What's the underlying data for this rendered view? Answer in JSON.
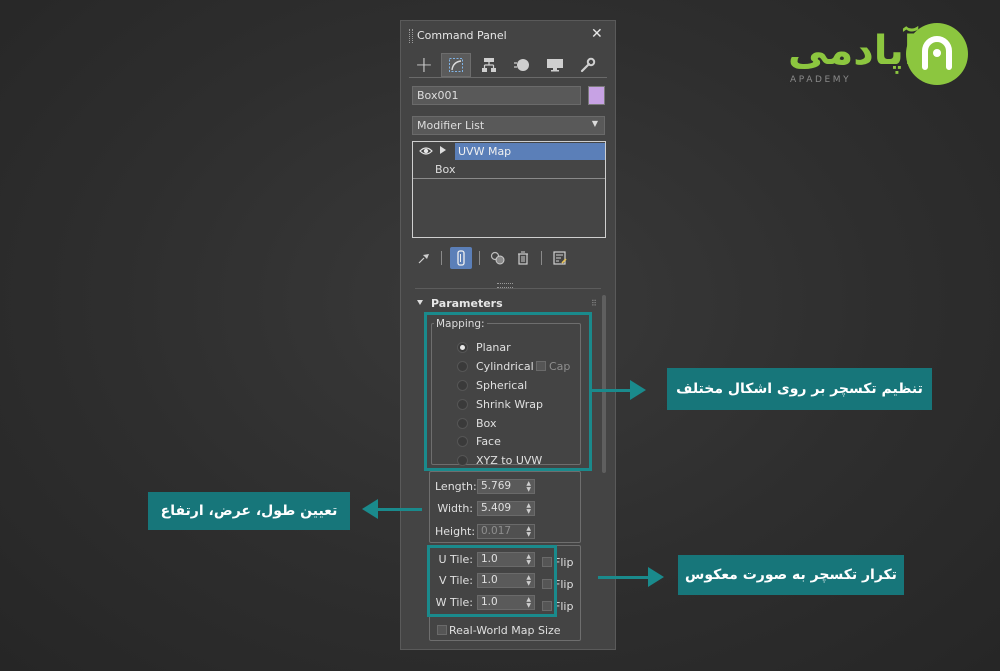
{
  "panel": {
    "title": "Command Panel",
    "close_glyph": "✕",
    "tabs": [
      {
        "name": "create",
        "icon": "plus-icon",
        "glyph": "+"
      },
      {
        "name": "modify",
        "icon": "modify-icon",
        "active": true
      },
      {
        "name": "hierarchy",
        "icon": "hierarchy-icon"
      },
      {
        "name": "motion",
        "icon": "motion-icon"
      },
      {
        "name": "display",
        "icon": "display-icon"
      },
      {
        "name": "utilities",
        "icon": "wrench-icon"
      }
    ],
    "object_name": "Box001",
    "object_color": "#c7a2e4",
    "modifier_list": "Modifier List",
    "stack": [
      {
        "label": "UVW Map",
        "selected": true
      },
      {
        "label": "Box",
        "selected": false
      }
    ],
    "rollout_title": "Parameters",
    "mapping": {
      "label": "Mapping:",
      "options": [
        {
          "label": "Planar",
          "selected": true
        },
        {
          "label": "Cylindrical",
          "selected": false
        },
        {
          "label": "Spherical",
          "selected": false
        },
        {
          "label": "Shrink Wrap",
          "selected": false
        },
        {
          "label": "Box",
          "selected": false
        },
        {
          "label": "Face",
          "selected": false
        },
        {
          "label": "XYZ to UVW",
          "selected": false
        }
      ],
      "cap_label": "Cap"
    },
    "dimensions": {
      "length_label": "Length:",
      "length": "5.769",
      "width_label": "Width:",
      "width": "5.409",
      "height_label": "Height:",
      "height": "0.017"
    },
    "tiling": {
      "u_label": "U Tile:",
      "u": "1.0",
      "v_label": "V Tile:",
      "v": "1.0",
      "w_label": "W Tile:",
      "w": "1.0",
      "flip_label": "Flip"
    },
    "real_world_label": "Real-World Map Size"
  },
  "annotations": {
    "mapping_callout": "تنظیم تکسچر بر روی اشکال مختلف",
    "dimensions_callout": "تعیین طول، عرض، ارتفاع",
    "tiling_callout": "تکرار تکسچر به صورت معکوس",
    "accent_color": "#17767a"
  },
  "logo": {
    "text": "آپادمی",
    "subtitle": "APADEMY",
    "color": "#8cc63f"
  }
}
